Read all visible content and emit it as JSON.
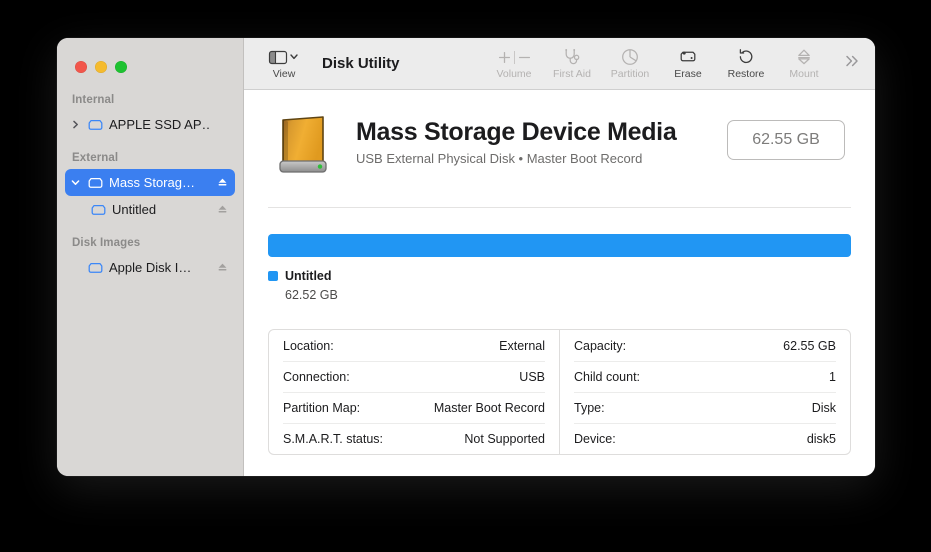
{
  "window": {
    "traffic_lights": {
      "close": "close",
      "minimize": "minimize",
      "maximize": "maximize"
    }
  },
  "toolbar": {
    "view_label": "View",
    "view_icon": "sidebar-toggle-icon",
    "view_chevron_icon": "chevron-down-icon",
    "app_title": "Disk Utility",
    "overflow_icon": "double-chevron-right-icon",
    "items": [
      {
        "label": "Volume",
        "icon": "plus-minus-icon",
        "enabled": false
      },
      {
        "label": "First Aid",
        "icon": "stethoscope-icon",
        "enabled": false
      },
      {
        "label": "Partition",
        "icon": "pie-chart-icon",
        "enabled": false
      },
      {
        "label": "Erase",
        "icon": "erase-disk-icon",
        "enabled": true
      },
      {
        "label": "Restore",
        "icon": "restore-arrow-icon",
        "enabled": true
      },
      {
        "label": "Mount",
        "icon": "eject-mount-icon",
        "enabled": false
      }
    ]
  },
  "sidebar": {
    "sections": [
      {
        "title": "Internal",
        "rows": [
          {
            "label": "APPLE SSD AP…",
            "disclosure": "collapsed",
            "icon": "internal-drive-icon",
            "eject": false,
            "selected": false,
            "indent": false
          }
        ]
      },
      {
        "title": "External",
        "rows": [
          {
            "label": "Mass Storag…",
            "disclosure": "expanded",
            "icon": "external-drive-icon",
            "eject": true,
            "selected": true,
            "indent": false
          },
          {
            "label": "Untitled",
            "disclosure": "none",
            "icon": "volume-drive-icon",
            "eject": true,
            "selected": false,
            "indent": true
          }
        ]
      },
      {
        "title": "Disk Images",
        "rows": [
          {
            "label": "Apple Disk I…",
            "disclosure": "none",
            "icon": "disk-image-icon",
            "eject": true,
            "selected": false,
            "indent": false
          }
        ]
      }
    ]
  },
  "disk": {
    "icon": "external-hard-drive-icon",
    "name": "Mass Storage Device Media",
    "subtitle": "USB External Physical Disk • Master Boot Record",
    "capacity_badge": "62.55 GB"
  },
  "usage": {
    "bar_color": "#2196f3",
    "segments": [
      {
        "name": "Untitled",
        "size": "62.52 GB",
        "percent": 100,
        "color": "#2196f3"
      }
    ]
  },
  "info": {
    "left": [
      {
        "key": "Location:",
        "value": "External"
      },
      {
        "key": "Connection:",
        "value": "USB"
      },
      {
        "key": "Partition Map:",
        "value": "Master Boot Record"
      },
      {
        "key": "S.M.A.R.T. status:",
        "value": "Not Supported"
      }
    ],
    "right": [
      {
        "key": "Capacity:",
        "value": "62.55 GB"
      },
      {
        "key": "Child count:",
        "value": "1"
      },
      {
        "key": "Type:",
        "value": "Disk"
      },
      {
        "key": "Device:",
        "value": "disk5"
      }
    ]
  },
  "colors": {
    "accent_blue": "#3b7ff0",
    "icon_blue": "#3b87f7",
    "bar_blue": "#2196f3",
    "sidebar_bg": "#d9d7d5",
    "toolbar_bg": "#ececec"
  }
}
